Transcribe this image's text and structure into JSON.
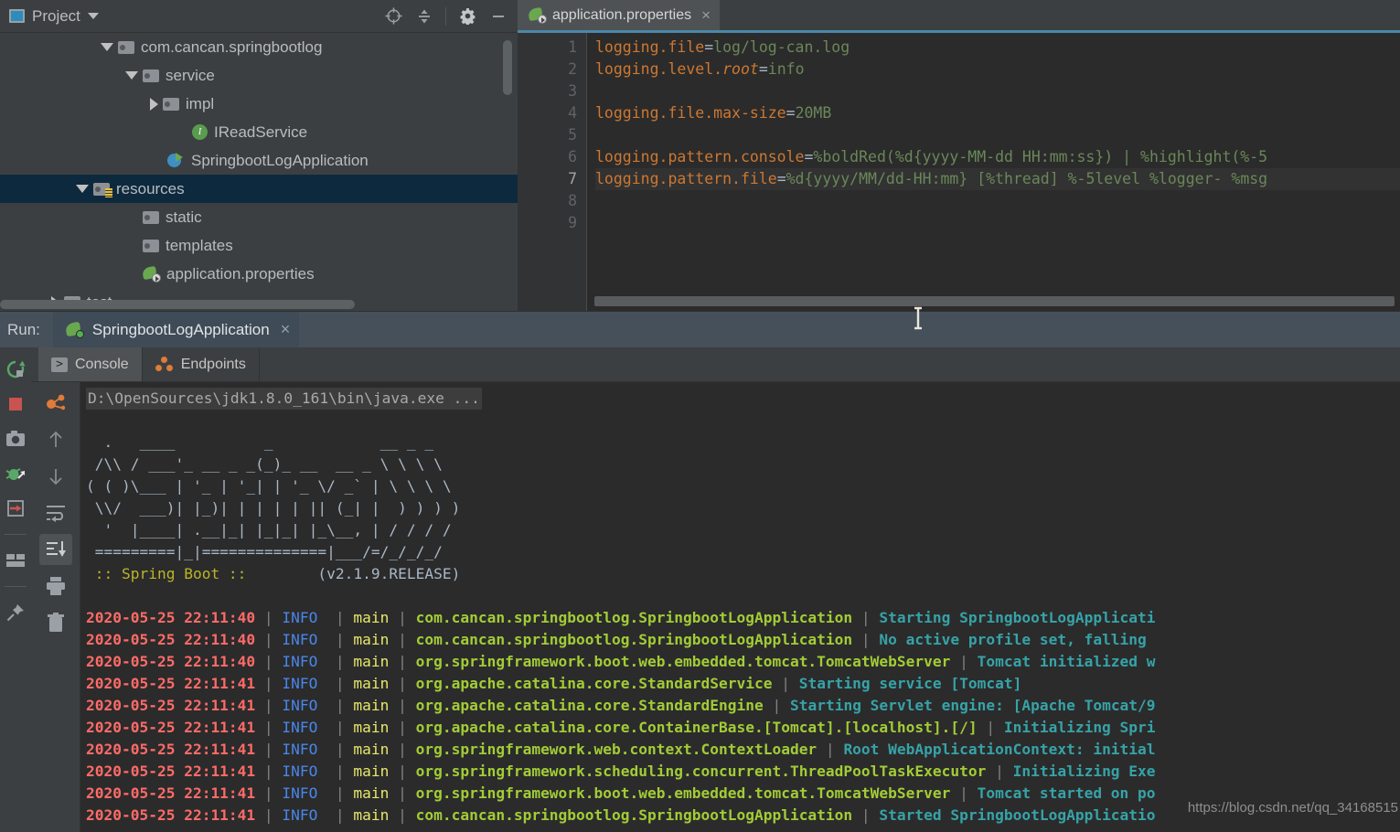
{
  "project_panel": {
    "title": "Project",
    "icons": [
      "locate-icon",
      "collapse-all-icon",
      "gear-icon",
      "minimize-icon"
    ],
    "tree": [
      {
        "label": "com.cancan.springbootlog",
        "icon": "folder-icon",
        "twisty": "down",
        "indent": 104,
        "selected": false
      },
      {
        "label": "service",
        "icon": "folder-icon",
        "twisty": "down",
        "indent": 131,
        "selected": false
      },
      {
        "label": "impl",
        "icon": "folder-icon",
        "twisty": "right",
        "indent": 158,
        "selected": false
      },
      {
        "label": "IReadService",
        "icon": "interface-icon",
        "twisty": "none",
        "indent": 185,
        "selected": false
      },
      {
        "label": "SpringbootLogApplication",
        "icon": "spring-application-icon",
        "twisty": "none",
        "indent": 158,
        "selected": false
      },
      {
        "label": "resources",
        "icon": "resources-folder-icon",
        "twisty": "down",
        "indent": 77,
        "selected": true
      },
      {
        "label": "static",
        "icon": "folder-icon",
        "twisty": "none",
        "indent": 131,
        "selected": false
      },
      {
        "label": "templates",
        "icon": "folder-icon",
        "twisty": "none",
        "indent": 131,
        "selected": false
      },
      {
        "label": "application.properties",
        "icon": "spring-properties-icon",
        "twisty": "none",
        "indent": 131,
        "selected": false
      },
      {
        "label": "test",
        "icon": "folder-icon",
        "twisty": "right",
        "indent": 50,
        "selected": false
      }
    ]
  },
  "editor": {
    "tab_label": "application.properties",
    "tab_close": "×",
    "line_numbers": [
      "1",
      "2",
      "3",
      "4",
      "5",
      "6",
      "7",
      "8",
      "9"
    ],
    "current_line": 7,
    "lines": [
      {
        "key": "logging.file",
        "value": "log/log-can.log"
      },
      {
        "key": "logging.level.",
        "key_italic": "root",
        "value": "info"
      },
      {
        "key": "",
        "value": ""
      },
      {
        "key": "logging.file.max-size",
        "value": "20MB"
      },
      {
        "key": "",
        "value": ""
      },
      {
        "key": "logging.pattern.console",
        "value": "%boldRed(%d{yyyy-MM-dd HH:mm:ss}) | %highlight(%-5"
      },
      {
        "key": "logging.pattern.file",
        "value": "%d{yyyy/MM/dd-HH:mm} [%thread] %-5level %logger- %msg"
      },
      {
        "key": "",
        "value": ""
      },
      {
        "key": "",
        "value": ""
      }
    ]
  },
  "run_panel": {
    "run_label": "Run:",
    "config_name": "SpringbootLogApplication",
    "config_close": "×",
    "left_toolbar": [
      "rerun-icon",
      "stop-icon",
      "camera-icon",
      "debug-attach-icon",
      "show-in-icon",
      "layout-icon",
      "pin-icon"
    ],
    "console_toolbar": [
      "thread-dump-icon",
      "up-arrow-icon",
      "down-arrow-icon",
      "soft-wrap-icon",
      "scroll-to-end-icon",
      "print-icon",
      "trash-icon"
    ],
    "tabs": [
      {
        "label": "Console",
        "icon": "console-icon",
        "active": true
      },
      {
        "label": "Endpoints",
        "icon": "endpoints-icon",
        "active": false
      }
    ],
    "command_line": "D:\\OpenSources\\jdk1.8.0_161\\bin\\java.exe ...",
    "banner_lines": [
      "  .   ____          _            __ _ _",
      " /\\\\ / ___'_ __ _ _(_)_ __  __ _ \\ \\ \\ \\",
      "( ( )\\___ | '_ | '_| | '_ \\/ _` | \\ \\ \\ \\",
      " \\\\/  ___)| |_)| | | | | || (_| |  ) ) ) )",
      "  '  |____| .__|_| |_|_| |_\\__, | / / / /",
      " =========|_|==============|___/=/_/_/_/"
    ],
    "banner_footer_label": " :: Spring Boot :: ",
    "banner_version": "       (v2.1.9.RELEASE)",
    "log_lines": [
      {
        "time": "2020-05-25 22:11:40",
        "level": "INFO",
        "thread": "main",
        "logger": "com.cancan.springbootlog.SpringbootLogApplication",
        "message": "Starting SpringbootLogApplicati"
      },
      {
        "time": "2020-05-25 22:11:40",
        "level": "INFO",
        "thread": "main",
        "logger": "com.cancan.springbootlog.SpringbootLogApplication",
        "message": "No active profile set, falling"
      },
      {
        "time": "2020-05-25 22:11:40",
        "level": "INFO",
        "thread": "main",
        "logger": "org.springframework.boot.web.embedded.tomcat.TomcatWebServer",
        "message": "Tomcat initialized w"
      },
      {
        "time": "2020-05-25 22:11:41",
        "level": "INFO",
        "thread": "main",
        "logger": "org.apache.catalina.core.StandardService",
        "message": "Starting service [Tomcat]"
      },
      {
        "time": "2020-05-25 22:11:41",
        "level": "INFO",
        "thread": "main",
        "logger": "org.apache.catalina.core.StandardEngine",
        "message": "Starting Servlet engine: [Apache Tomcat/9"
      },
      {
        "time": "2020-05-25 22:11:41",
        "level": "INFO",
        "thread": "main",
        "logger": "org.apache.catalina.core.ContainerBase.[Tomcat].[localhost].[/]",
        "message": "Initializing Spri"
      },
      {
        "time": "2020-05-25 22:11:41",
        "level": "INFO",
        "thread": "main",
        "logger": "org.springframework.web.context.ContextLoader",
        "message": "Root WebApplicationContext: initial"
      },
      {
        "time": "2020-05-25 22:11:41",
        "level": "INFO",
        "thread": "main",
        "logger": "org.springframework.scheduling.concurrent.ThreadPoolTaskExecutor",
        "message": "Initializing Exe"
      },
      {
        "time": "2020-05-25 22:11:41",
        "level": "INFO",
        "thread": "main",
        "logger": "org.springframework.boot.web.embedded.tomcat.TomcatWebServer",
        "message": "Tomcat started on po"
      },
      {
        "time": "2020-05-25 22:11:41",
        "level": "INFO",
        "thread": "main",
        "logger": "com.cancan.springbootlog.SpringbootLogApplication",
        "message": "Started SpringbootLogApplicatio"
      }
    ]
  },
  "watermark": "https://blog.csdn.net/qq_34168515",
  "colors": {
    "panel_bg": "#3c3f41",
    "editor_bg": "#2b2b2b",
    "selection_blue": "#0d293e",
    "run_bar": "#46505a",
    "tab_accent": "#4a88a8",
    "log_time": "#ff6b68",
    "log_level": "#4a86e8",
    "log_thread": "#e8e86a",
    "log_logger": "#a2cc36",
    "log_message": "#36a3a8"
  }
}
